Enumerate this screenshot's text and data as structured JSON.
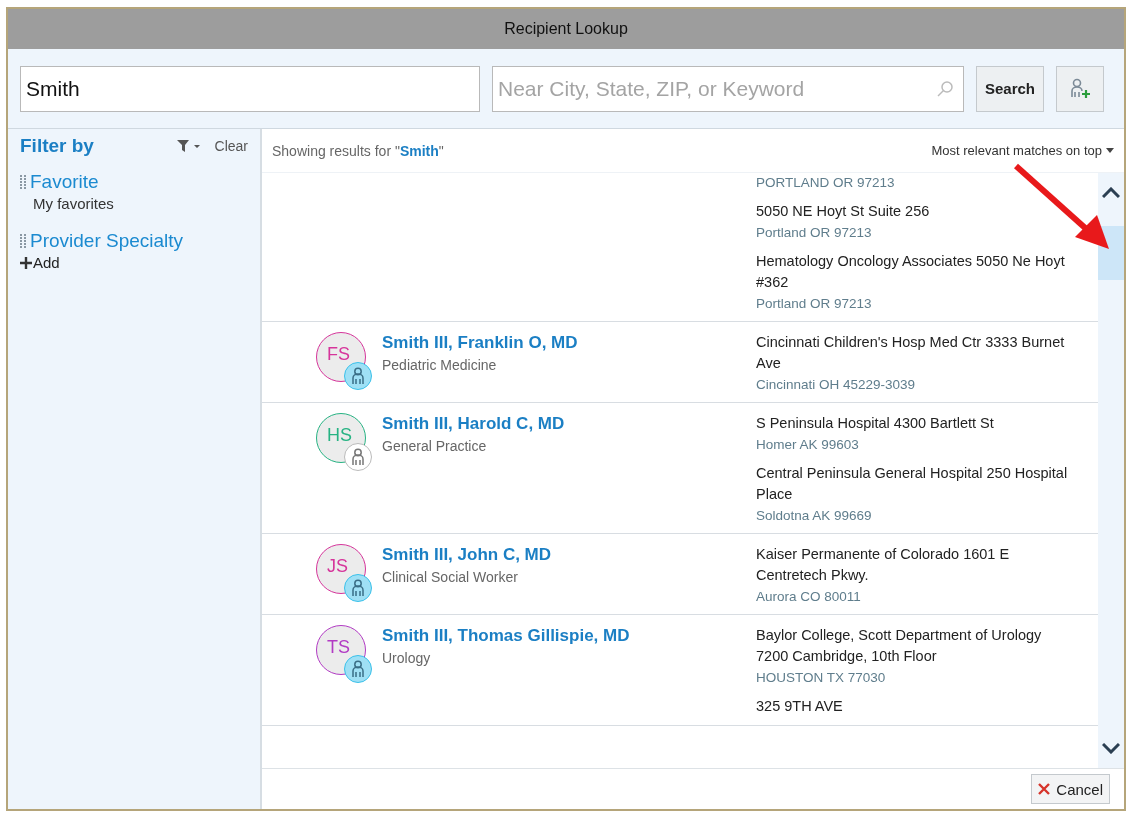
{
  "window": {
    "title": "Recipient Lookup"
  },
  "search": {
    "name_value": "Smith",
    "location_placeholder": "Near City, State, ZIP, or Keyword",
    "button": "Search"
  },
  "filters": {
    "title": "Filter by",
    "clear": "Clear",
    "groups": [
      {
        "title": "Favorite",
        "items": [
          "My favorites"
        ]
      },
      {
        "title": "Provider Specialty"
      }
    ],
    "add": "Add"
  },
  "results_header": {
    "prefix": "Showing results for \"",
    "query": "Smith",
    "suffix": "\"",
    "sort": "Most relevant matches on top"
  },
  "results": [
    {
      "locations": [
        {
          "city": "PORTLAND OR 97213"
        },
        {
          "address": "5050 NE Hoyt St Suite 256",
          "city": "Portland OR 97213"
        },
        {
          "address": "Hematology Oncology Associates 5050 Ne Hoyt #362",
          "city": "Portland OR 97213"
        }
      ]
    },
    {
      "initials": "FS",
      "color": "#d6359b",
      "badge_highlighted": true,
      "name": "Smith III, Franklin O, MD",
      "specialty": "Pediatric Medicine",
      "locations": [
        {
          "address": "Cincinnati Children's Hosp Med Ctr 3333 Burnet Ave",
          "city": "Cincinnati OH 45229-3039"
        }
      ]
    },
    {
      "initials": "HS",
      "color": "#27b383",
      "badge_highlighted": false,
      "name": "Smith III, Harold C, MD",
      "specialty": "General Practice",
      "locations": [
        {
          "address": "S Peninsula Hospital 4300 Bartlett St",
          "city": "Homer AK 99603"
        },
        {
          "address": "Central Peninsula General Hospital 250 Hospital Place",
          "city": "Soldotna AK 99669"
        }
      ]
    },
    {
      "initials": "JS",
      "color": "#d6359b",
      "badge_highlighted": true,
      "name": "Smith III, John C, MD",
      "specialty": "Clinical Social Worker",
      "locations": [
        {
          "address": "Kaiser Permanente of Colorado 1601 E Centretech Pkwy.",
          "city": "Aurora CO 80011"
        }
      ]
    },
    {
      "initials": "TS",
      "color": "#b23bc4",
      "badge_highlighted": true,
      "name": "Smith III, Thomas Gillispie, MD",
      "specialty": "Urology",
      "locations": [
        {
          "address": "Baylor College, Scott Department of Urology 7200 Cambridge, 10th Floor",
          "city": "HOUSTON TX 77030"
        },
        {
          "address": "325 9TH AVE"
        }
      ]
    }
  ],
  "footer": {
    "cancel": "Cancel"
  }
}
